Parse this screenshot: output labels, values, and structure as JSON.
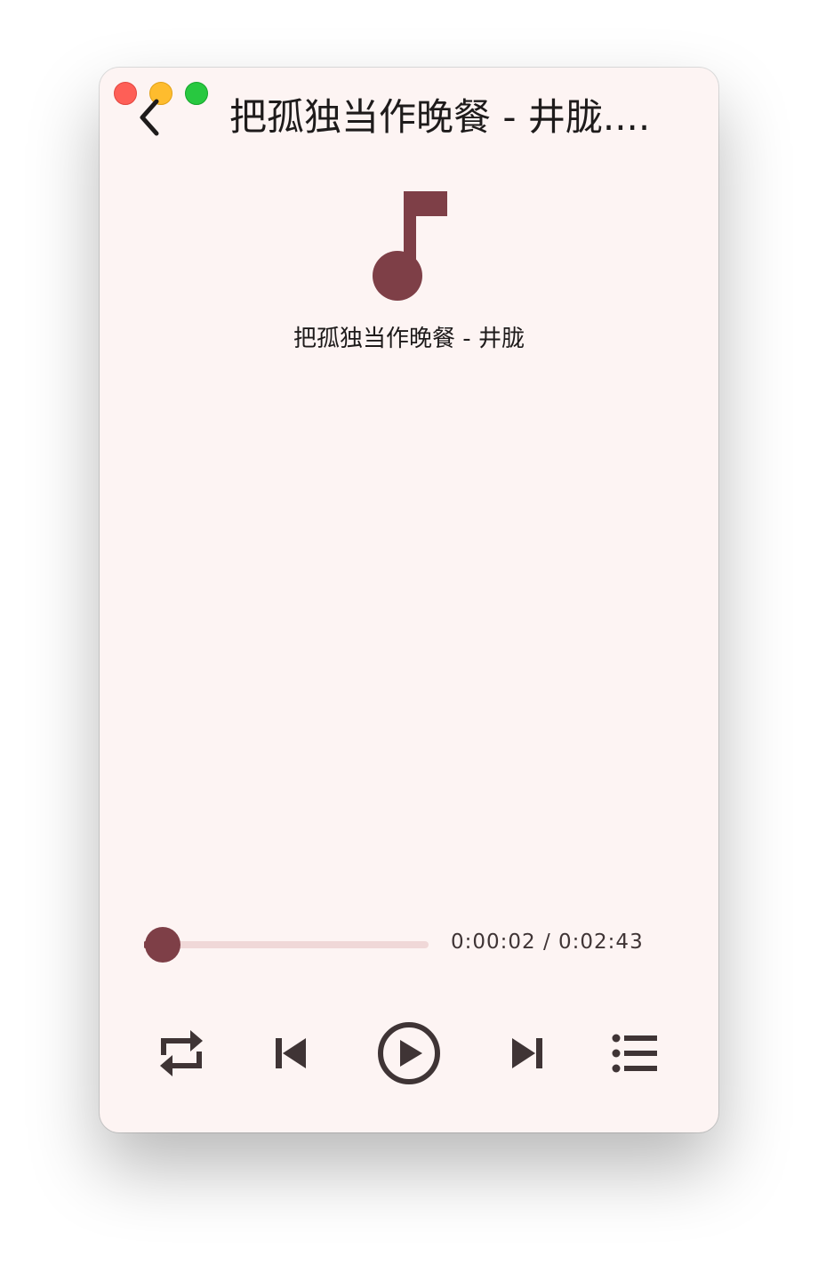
{
  "window": {
    "title": "把孤独当作晚餐 - 井胧....",
    "controls": [
      "close",
      "minimize",
      "maximize"
    ]
  },
  "header": {
    "back_icon": "chevron-left-icon"
  },
  "now_playing": {
    "artwork_icon": "music-note-icon",
    "track_name": "把孤独当作晚餐 - 井胧"
  },
  "progress": {
    "fraction": 0.012,
    "time_display": "0:00:02 / 0:02:43"
  },
  "controls": {
    "repeat_icon": "repeat-icon",
    "previous_icon": "skip-previous-icon",
    "play_icon": "play-circle-icon",
    "next_icon": "skip-next-icon",
    "playlist_icon": "playlist-icon"
  },
  "colors": {
    "background": "#fdf4f3",
    "accent": "#7e3f47",
    "track": "#f0d8d8",
    "icon": "#3f3435",
    "text": "#1e1b1b"
  }
}
